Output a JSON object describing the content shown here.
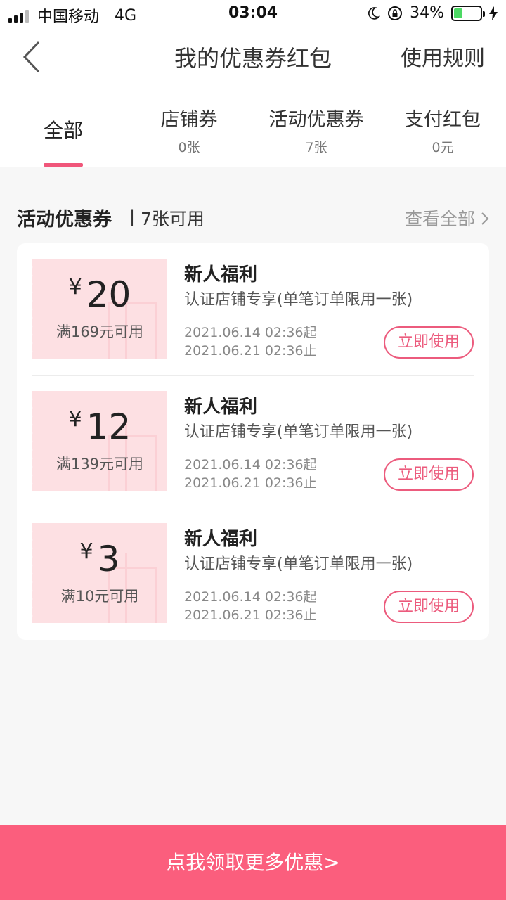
{
  "status_bar": {
    "carrier": "中国移动",
    "network": "4G",
    "time": "03:04",
    "battery_text": "34%",
    "battery_level": 34,
    "battery_color": "#4cd964"
  },
  "header": {
    "title": "我的优惠券红包",
    "rules_label": "使用规则",
    "back_icon": "chevron-left-icon"
  },
  "tabs": [
    {
      "label": "全部",
      "count": ""
    },
    {
      "label": "店铺券",
      "count": "0张"
    },
    {
      "label": "活动优惠券",
      "count": "7张"
    },
    {
      "label": "支付红包",
      "count": "0元"
    }
  ],
  "section": {
    "title": "活动优惠券",
    "separator": "|",
    "count": "7张可用",
    "view_all": "查看全部",
    "view_all_icon": "chevron-right-icon"
  },
  "coupons": [
    {
      "currency": "¥",
      "amount": "20",
      "condition": "满169元可用",
      "title": "新人福利",
      "desc": "认证店铺专享(单笔订单限用一张)",
      "start": "2021.06.14 02:36起",
      "end": "2021.06.21 02:36止",
      "button": "立即使用"
    },
    {
      "currency": "¥",
      "amount": "12",
      "condition": "满139元可用",
      "title": "新人福利",
      "desc": "认证店铺专享(单笔订单限用一张)",
      "start": "2021.06.14 02:36起",
      "end": "2021.06.21 02:36止",
      "button": "立即使用"
    },
    {
      "currency": "¥",
      "amount": "3",
      "condition": "满10元可用",
      "title": "新人福利",
      "desc": "认证店铺专享(单笔订单限用一张)",
      "start": "2021.06.14 02:36起",
      "end": "2021.06.21 02:36止",
      "button": "立即使用"
    }
  ],
  "bottom_cta": "点我领取更多优惠>",
  "colors": {
    "accent": "#fb5e7d",
    "button_border": "#ec5b7d",
    "ticket_bg": "#fde0e3",
    "tab_underline": "#f0567a"
  }
}
